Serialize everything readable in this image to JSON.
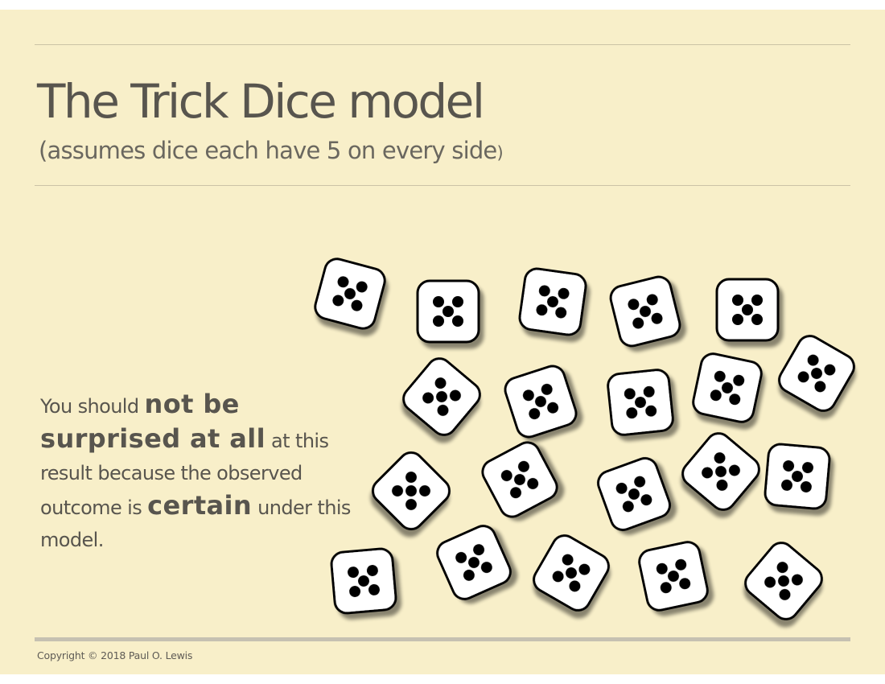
{
  "slide": {
    "title": "The Trick Dice model",
    "subtitle_open": "(",
    "subtitle_main": "assumes dice each have 5 on every side",
    "subtitle_close": ")",
    "body": {
      "part1": "You should ",
      "emph1": "not be surprised at all",
      "part2": " at this result because the observed outcome is ",
      "emph2": "certain",
      "part3": " under this model."
    },
    "copyright": "Copyright © 2018 Paul O. Lewis"
  },
  "dice": {
    "face_value": 5,
    "count": 20,
    "face_color": "#ffffff",
    "pip_color": "#000000"
  }
}
